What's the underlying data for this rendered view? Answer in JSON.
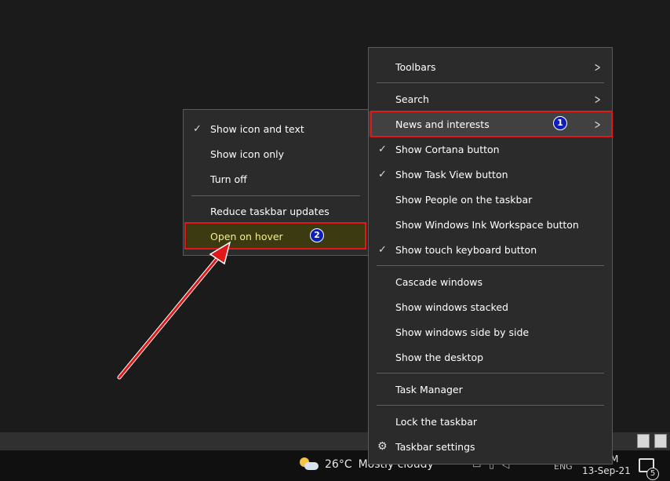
{
  "colors": {
    "menu_bg": "#2b2b2b",
    "highlight_box": "#e01818",
    "step_badge": "#0d1fb8",
    "hover_text": "#f3f08a",
    "arrow": "#e01818"
  },
  "main_menu": {
    "items": [
      {
        "label": "Toolbars",
        "checked": false,
        "submenu": true
      },
      {
        "label": "Search",
        "checked": false,
        "submenu": true
      },
      {
        "label": "News and interests",
        "checked": false,
        "submenu": true,
        "badge": "1"
      },
      {
        "label": "Show Cortana button",
        "checked": true
      },
      {
        "label": "Show Task View button",
        "checked": true
      },
      {
        "label": "Show People on the taskbar",
        "checked": false
      },
      {
        "label": "Show Windows Ink Workspace button",
        "checked": false
      },
      {
        "label": "Show touch keyboard button",
        "checked": true
      },
      {
        "label": "Cascade windows"
      },
      {
        "label": "Show windows stacked"
      },
      {
        "label": "Show windows side by side"
      },
      {
        "label": "Show the desktop"
      },
      {
        "label": "Task Manager"
      },
      {
        "label": "Lock the taskbar"
      },
      {
        "label": "Taskbar settings",
        "icon": "gear-icon"
      }
    ]
  },
  "sub_menu": {
    "items": [
      {
        "label": "Show icon and text",
        "checked": true
      },
      {
        "label": "Show icon only"
      },
      {
        "label": "Turn off"
      },
      {
        "label": "Reduce taskbar updates"
      },
      {
        "label": "Open on hover",
        "badge": "2"
      }
    ]
  },
  "taskbar": {
    "weather_temp": "26°C",
    "weather_text": "Mostly cloudy",
    "language": "ENG",
    "clock_time": "M",
    "clock_date": "13-Sep-21",
    "notification_count": "5"
  },
  "check_glyph": "✓",
  "chevron_glyph": ">"
}
